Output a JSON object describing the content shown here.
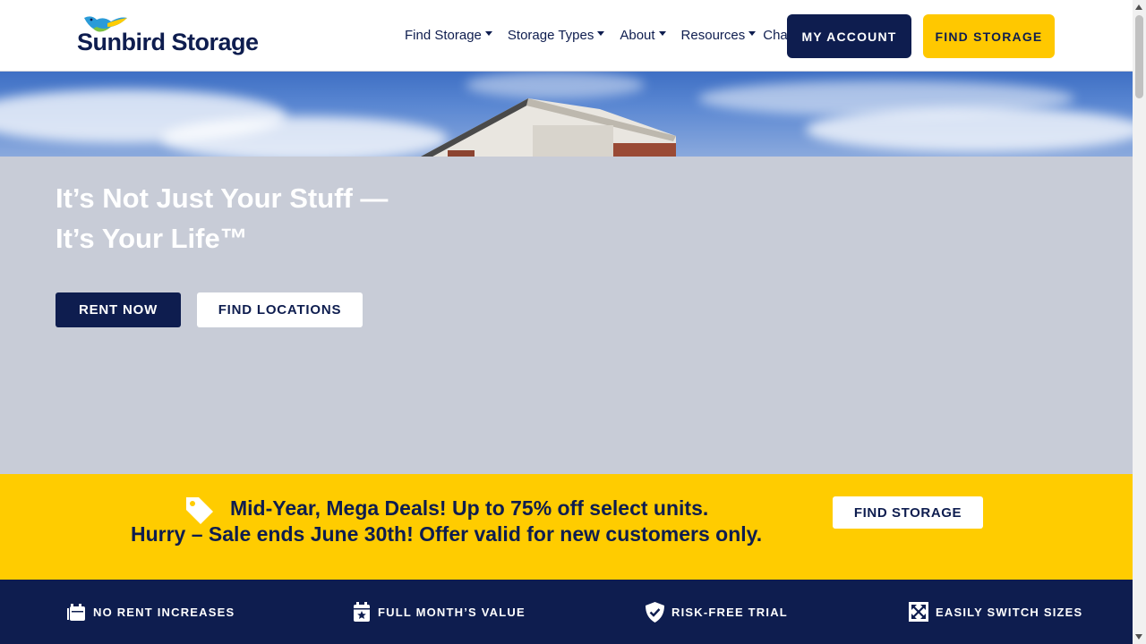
{
  "brand": {
    "name": "Sunbird Storage",
    "logo_icon": "sunbird-logo-icon",
    "colors": {
      "navy": "#0e1d4f",
      "yellow": "#ffcc00",
      "hero_gray": "#c8ccd7"
    }
  },
  "nav": {
    "items": [
      {
        "label": "Find Storage",
        "dropdown": true
      },
      {
        "label": "Storage Types",
        "dropdown": true
      },
      {
        "label": "About",
        "dropdown": true
      },
      {
        "label": "Resources",
        "dropdown": true
      },
      {
        "label": "Chat",
        "dropdown": false
      }
    ],
    "my_account": "MY ACCOUNT",
    "find_storage": "FIND STORAGE"
  },
  "hero": {
    "title_line1": "It’s Not Just Your Stuff —",
    "title_line2": "It’s Your Life™",
    "rent_now": "RENT NOW",
    "find_locations": "FIND LOCATIONS"
  },
  "promo": {
    "icon": "price-tag-icon",
    "line1": "Mid-Year, Mega Deals! Up to 75% off select units.",
    "line2": "Hurry – Sale ends June 30th! Offer valid for new customers only.",
    "button": "FIND STORAGE"
  },
  "features": [
    {
      "icon": "calendar-stack-icon",
      "label": "NO RENT INCREASES"
    },
    {
      "icon": "calendar-star-icon",
      "label": "FULL MONTH’S VALUE"
    },
    {
      "icon": "shield-check-icon",
      "label": "RISK-FREE TRIAL"
    },
    {
      "icon": "arrows-expand-icon",
      "label": "EASILY SWITCH SIZES"
    }
  ]
}
